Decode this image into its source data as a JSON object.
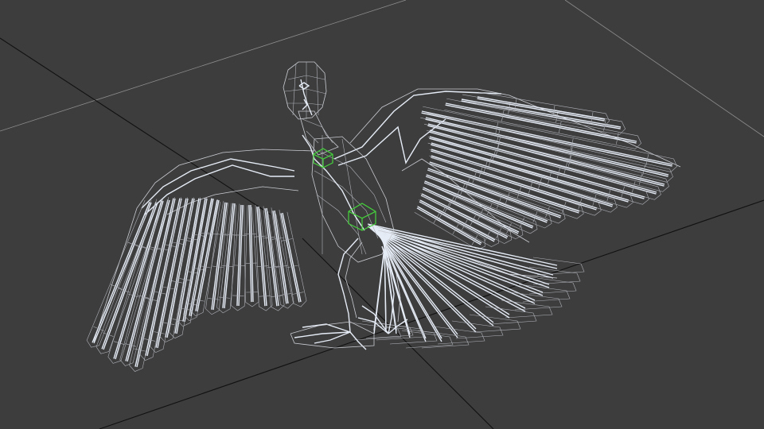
{
  "viewport": {
    "label": "",
    "background_color": "#3d3d3d",
    "grid_color": "#8d8d8d",
    "grid_axis_color": "#111111",
    "wireframe_color": "#c9ccd2",
    "bone_color": "#e6ecf6",
    "helper_color": "#45d13c",
    "grid_visible": true,
    "render_mode": "wireframe"
  },
  "scene": {
    "object": "winged-creature-rig",
    "helpers": [
      "chest-helper",
      "pelvis-helper"
    ]
  }
}
